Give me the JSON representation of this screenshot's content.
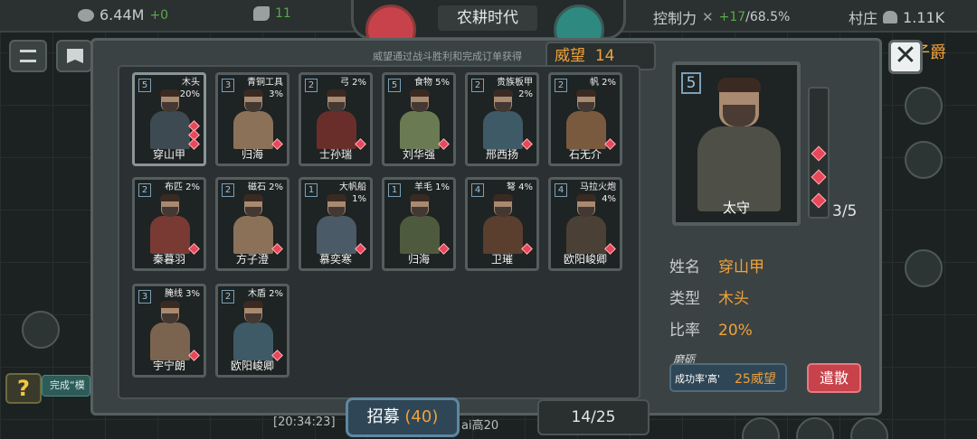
{
  "top": {
    "coins": "6.44M",
    "coins_delta": "+0",
    "strength": "11",
    "era_title": "农耕时代",
    "control_label": "控制力",
    "control_delta": "+17",
    "control_value": "/68.5%",
    "village_label": "村庄",
    "village_value": "1.11K"
  },
  "panel": {
    "subtitle": "威望通过战斗胜利和完成订单获得",
    "prestige_label": "威望",
    "prestige_value": "14",
    "rank_label": "子爵"
  },
  "cards": [
    {
      "level": "5",
      "resource": "木头\n20%",
      "name": "穿山甲",
      "gems": 3,
      "tone": "#3e4a52"
    },
    {
      "level": "3",
      "resource": "青铜工具\n3%",
      "name": "归海",
      "gems": 1,
      "tone": "#8a7158"
    },
    {
      "level": "2",
      "resource": "弓 2%",
      "name": "士孙瑞",
      "gems": 1,
      "tone": "#6a2e2a"
    },
    {
      "level": "5",
      "resource": "食物 5%",
      "name": "刘华强",
      "gems": 1,
      "tone": "#6a7a52"
    },
    {
      "level": "2",
      "resource": "贵族板甲\n2%",
      "name": "邢西扬",
      "gems": 1,
      "tone": "#3e5a66"
    },
    {
      "level": "2",
      "resource": "帆 2%",
      "name": "石无介",
      "gems": 1,
      "tone": "#7a5a3e"
    },
    {
      "level": "2",
      "resource": "布匹 2%",
      "name": "秦暮羽",
      "gems": 1,
      "tone": "#7a3a34"
    },
    {
      "level": "2",
      "resource": "磁石 2%",
      "name": "方子澄",
      "gems": 1,
      "tone": "#8a7158"
    },
    {
      "level": "1",
      "resource": "大帆船\n1%",
      "name": "慕奕寒",
      "gems": 1,
      "tone": "#4a5a66"
    },
    {
      "level": "1",
      "resource": "羊毛 1%",
      "name": "归海",
      "gems": 1,
      "tone": "#4e5a3e"
    },
    {
      "level": "4",
      "resource": "弩 4%",
      "name": "卫璀",
      "gems": 1,
      "tone": "#5a3e2e"
    },
    {
      "level": "4",
      "resource": "马拉火炮\n4%",
      "name": "欧阳峻卿",
      "gems": 1,
      "tone": "#4a4036"
    },
    {
      "level": "3",
      "resource": "腌线 3%",
      "name": "宇宁朗",
      "gems": 1,
      "tone": "#7a6450"
    },
    {
      "level": "2",
      "resource": "木盾 2%",
      "name": "欧阳峻卿",
      "gems": 1,
      "tone": "#3e5a66"
    }
  ],
  "detail": {
    "level": "5",
    "title": "太守",
    "trait_count": "3/5",
    "name_label": "姓名",
    "name_value": "穿山甲",
    "type_label": "类型",
    "type_value": "木头",
    "ratio_label": "比率",
    "ratio_value": "20%",
    "polish_label": "磨砺",
    "success_rate": "成功率'高'",
    "cost": "25威望",
    "dismiss": "遣散"
  },
  "bottom": {
    "recruit_label": "招募",
    "recruit_count": "(40)",
    "pager": "14/25",
    "log_time": "[20:34:23]",
    "log_tail": "ai高20",
    "hint": "完成“模",
    "help": "?"
  },
  "colors": {
    "accent": "#f0a23a",
    "gem": "#e8485a",
    "dismiss": "#c7424a"
  }
}
